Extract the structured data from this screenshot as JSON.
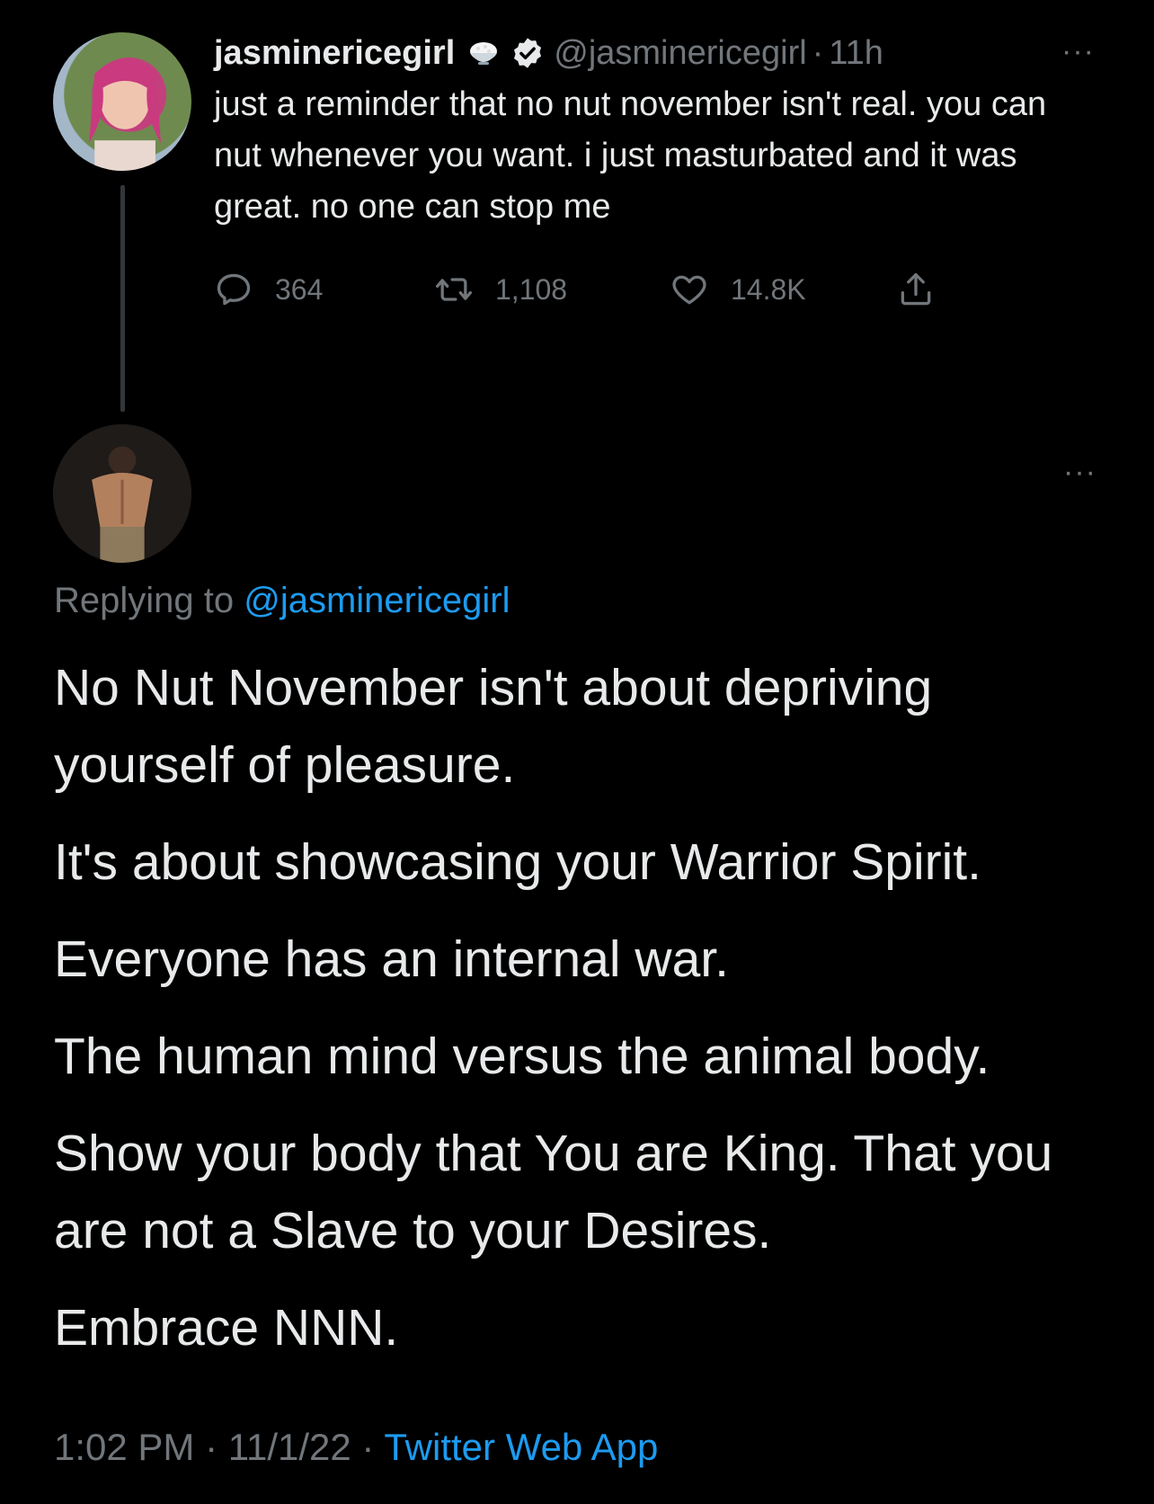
{
  "original_tweet": {
    "display_name": "jasminericegirl",
    "name_emoji": "rice-bowl-icon",
    "verified_icon": "verified-badge-icon",
    "handle": "@jasminericegirl",
    "separator": "·",
    "time": "11h",
    "more": "···",
    "text": "just a reminder that no nut november isn't real. you can nut whenever you want. i just masturbated and it was great. no one can stop me",
    "stats": {
      "replies": "364",
      "retweets": "1,108",
      "likes": "14.8K"
    }
  },
  "reply_tweet": {
    "more": "···",
    "replying_prefix": "Replying to ",
    "replying_mention": "@jasminericegirl",
    "paragraphs": [
      "No Nut November isn't about depriving yourself of pleasure.",
      "It's about showcasing your Warrior Spirit.",
      "Everyone has an internal war.",
      "The human mind versus the animal body.",
      "Show your body that You are King. That you are not a Slave to your Desires.",
      "Embrace NNN."
    ],
    "footer": {
      "time": "1:02 PM",
      "sep1": " · ",
      "date": "11/1/22",
      "sep2": " · ",
      "source": "Twitter Web App"
    }
  },
  "colors": {
    "background": "#000000",
    "text": "#e7e9ea",
    "muted": "#71767b",
    "link": "#1d9bf0",
    "verified": "#e7e9ea"
  }
}
